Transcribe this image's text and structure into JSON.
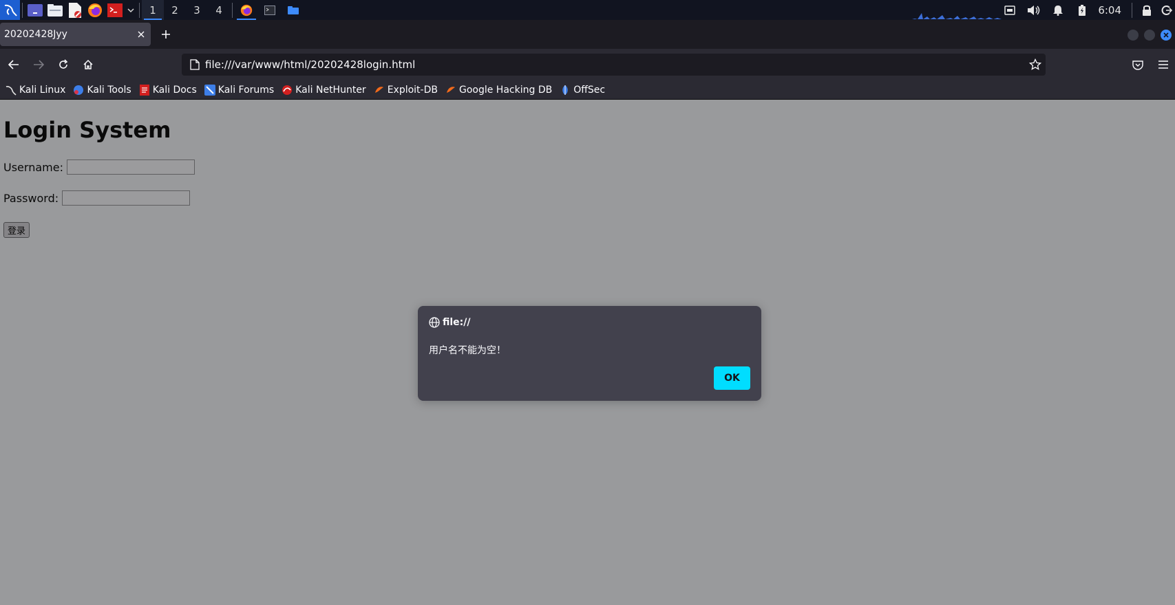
{
  "taskbar": {
    "workspaces": [
      "1",
      "2",
      "3",
      "4"
    ],
    "active_workspace": "1",
    "clock": "6:04",
    "accent_color": "#3d8bfd"
  },
  "browser": {
    "tab_title": "20202428Jyy",
    "url": "file:///var/www/html/20202428login.html",
    "bookmarks": [
      "Kali Linux",
      "Kali Tools",
      "Kali Docs",
      "Kali Forums",
      "Kali NetHunter",
      "Exploit-DB",
      "Google Hacking DB",
      "OffSec"
    ]
  },
  "page": {
    "heading": "Login System",
    "username_label": "Username:",
    "password_label": "Password:",
    "login_button": "登录"
  },
  "dialog": {
    "origin": "file://",
    "message": "用户名不能为空！",
    "ok_label": "OK",
    "ok_color": "#00ddff"
  }
}
